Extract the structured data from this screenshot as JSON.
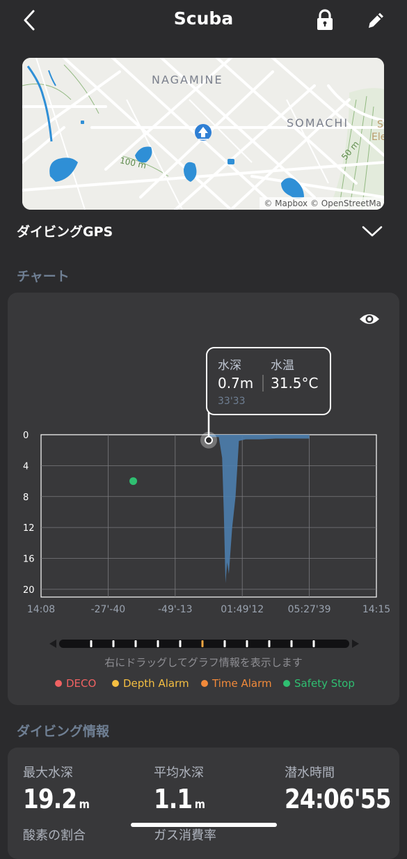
{
  "header": {
    "title": "Scuba",
    "back_icon": "chevron-left-icon",
    "lock_icon": "lock-icon",
    "edit_icon": "pencil-icon"
  },
  "map": {
    "labels": [
      "NAGAMINE",
      "SOMACHI",
      "S",
      "Ele"
    ],
    "contour_labels": [
      "100 m",
      "50 m"
    ],
    "attribution": "© Mapbox © OpenStreetMa"
  },
  "gps": {
    "label": "ダイビングGPS",
    "chevron_icon": "chevron-down-icon"
  },
  "chart_section": {
    "title": "チャート"
  },
  "chart_data": {
    "type": "area",
    "y_axis": {
      "reversed": true,
      "ticks": [
        0,
        4,
        8,
        12,
        16,
        20
      ],
      "range": [
        0,
        21
      ]
    },
    "x_tick_labels": [
      "14:08",
      "-27'-40",
      "-49'-13",
      "01:49'12",
      "05:27'39",
      "14:15"
    ],
    "depth_profile": {
      "x": [
        0.0,
        0.06,
        0.08,
        0.09,
        0.1,
        0.11,
        0.12,
        0.13,
        0.14,
        0.16,
        0.18,
        0.2,
        0.22,
        0.3,
        0.4,
        0.5,
        0.6
      ],
      "y": [
        0.3,
        0.3,
        3.0,
        10.0,
        19.2,
        16.5,
        18.0,
        15.0,
        12.0,
        8.0,
        0.8,
        0.7,
        0.6,
        0.6,
        0.5,
        0.5,
        0.5
      ]
    },
    "safety_stop_point": {
      "x": -0.45,
      "y": 6.0
    },
    "cursor": {
      "x": 0.0,
      "y": 0.7
    },
    "grid": true
  },
  "tooltip": {
    "depth_label": "水深",
    "depth_value": "0.7m",
    "temp_label": "水温",
    "temp_value": "31.5°C",
    "time": "33'33"
  },
  "scrubber": {
    "ticks": 11,
    "active_index": 5,
    "active_color": "#f5a742"
  },
  "hint": "右にドラッグしてグラフ情報を表示します",
  "legend": [
    {
      "label": "DECO",
      "color": "#f06262"
    },
    {
      "label": "Depth Alarm",
      "color": "#f5bf42"
    },
    {
      "label": "Time Alarm",
      "color": "#f28a3a"
    },
    {
      "label": "Safety Stop",
      "color": "#2fbf71"
    }
  ],
  "info_section": {
    "title": "ダイビング情報"
  },
  "info": {
    "max_depth_label": "最大水深",
    "max_depth_value": "19.2",
    "max_depth_unit": "m",
    "avg_depth_label": "平均水深",
    "avg_depth_value": "1.1",
    "avg_depth_unit": "m",
    "dive_time_label": "潜水時間",
    "dive_time_value": "24:06'55",
    "oxygen_label": "酸素の割合",
    "gas_label": "ガス消費率"
  },
  "colors": {
    "background": "#2b2b2d",
    "card": "#38383a",
    "series": "#4d7eae"
  }
}
